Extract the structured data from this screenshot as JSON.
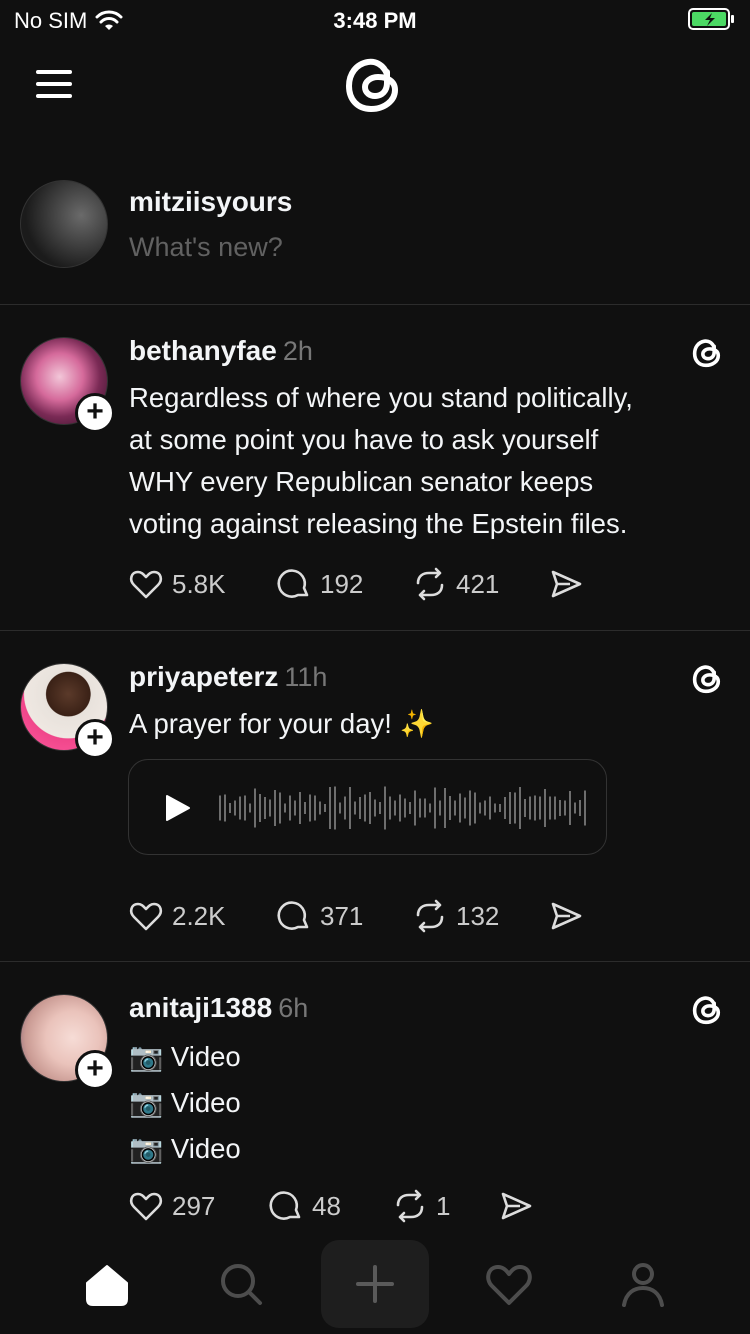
{
  "status_bar": {
    "carrier": "No SIM",
    "time": "3:48 PM",
    "icons": [
      "wifi-icon",
      "battery-charging-icon"
    ],
    "battery_color": "#4cd964"
  },
  "header": {
    "icons": [
      "menu-icon",
      "threads-logo"
    ]
  },
  "composer": {
    "username": "mitziisyours",
    "placeholder": "What's new?"
  },
  "posts": [
    {
      "username": "bethanyfae",
      "time": "2h",
      "lines": [
        "Regardless of where you stand politically,",
        "at some point you have to ask yourself",
        "WHY every Republican senator keeps",
        "voting against releasing the Epstein files."
      ],
      "likes": "5.8K",
      "replies": "192",
      "reposts": "421"
    },
    {
      "username": "priyapeterz",
      "time": "11h",
      "lines": [
        "A prayer for your day! ✨"
      ],
      "has_audio": true,
      "likes": "2.2K",
      "replies": "371",
      "reposts": "132"
    },
    {
      "username": "anitaji1388",
      "time": "6h",
      "lines": [
        "📷 Video",
        "📷 Video",
        "📷 Video"
      ],
      "likes": "297",
      "replies": "48",
      "reposts": "1"
    }
  ],
  "tab_bar": {
    "tabs": [
      "home-icon",
      "search-icon",
      "plus-icon",
      "heart-icon",
      "profile-icon"
    ],
    "active": "home-icon"
  },
  "colors": {
    "background": "#101010",
    "text": "#f3f5f7",
    "muted": "#777777",
    "divider": "#2c2c2c"
  }
}
